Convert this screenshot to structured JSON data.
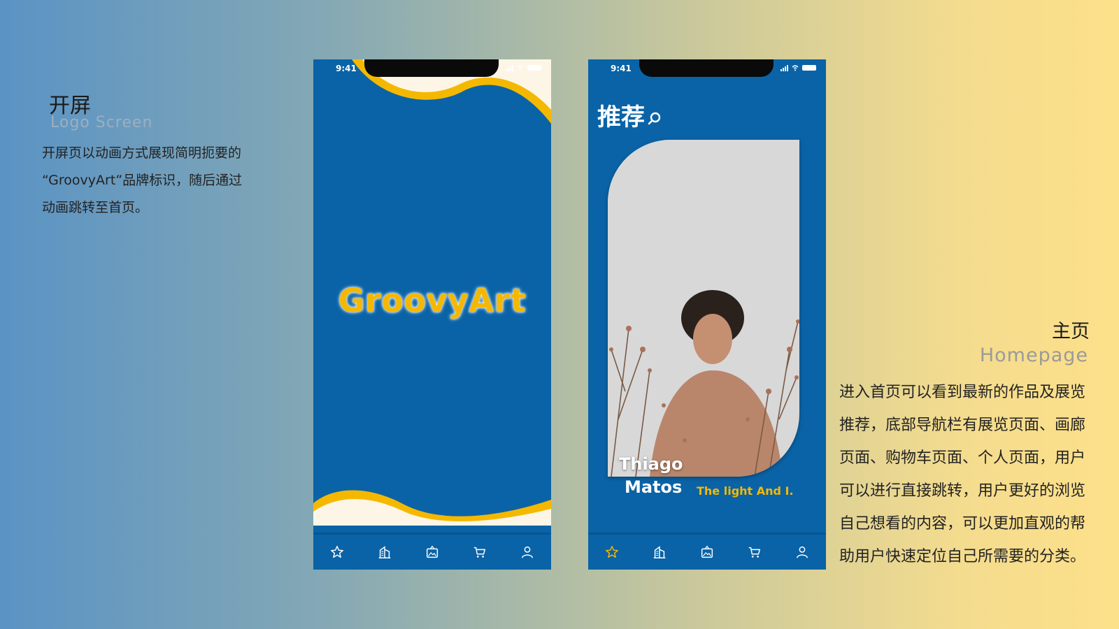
{
  "left": {
    "title": "开屏",
    "subtitle": "Logo Screen",
    "lines": [
      "开屏页以动画方式展现简明扼要的",
      "“GroovyArt”品牌标识，随后通过",
      "动画跳转至首页。"
    ]
  },
  "right": {
    "title": "主页",
    "subtitle": "Homepage",
    "lines": [
      "进入首页可以看到最新的作品及展览",
      "推荐，底部导航栏有展览页面、画廊",
      "页面、购物车页面、个人页面，用户",
      "可以进行直接跳转，用户更好的浏览",
      "自己想看的内容，可以更加直观的帮",
      "助用户快速定位自己所需要的分类。"
    ]
  },
  "phone_splash": {
    "time": "9:41",
    "logo": "GroovyArt"
  },
  "phone_home": {
    "time": "9:41",
    "header": "推荐",
    "artist_first": "Thiago",
    "artist_last": "Matos",
    "artwork_title": "The light And I."
  },
  "tabbar": {
    "icons": [
      "star-icon",
      "gallery-building-icon",
      "picture-frame-icon",
      "cart-icon",
      "user-icon"
    ]
  },
  "colors": {
    "brand_blue": "#0a63a6",
    "brand_yellow": "#f5b800",
    "cream": "#fdf6e6"
  }
}
